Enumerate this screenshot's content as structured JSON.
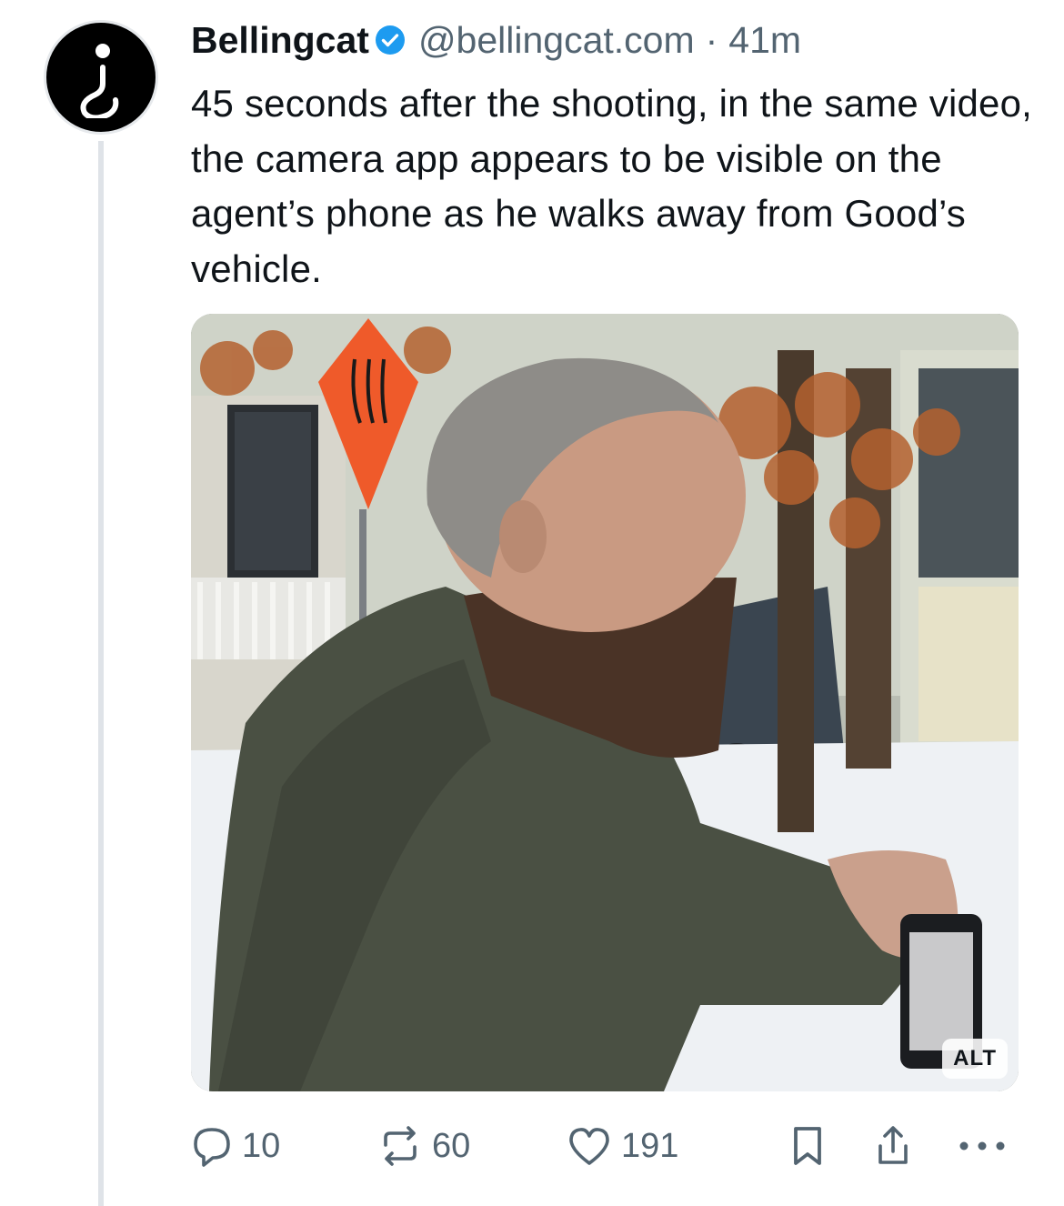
{
  "post": {
    "author": {
      "display_name": "Bellingcat",
      "handle": "@bellingcat.com",
      "separator": "·",
      "time": "41m",
      "verified": true,
      "avatar_icon": "inverted-question-mark-icon"
    },
    "text": "45 seconds after the shooting, in the same video, the camera app appears to be visible on the agent’s phone as he walks away from Good’s vehicle.",
    "media": {
      "alt_badge": "ALT"
    },
    "actions": {
      "replies": "10",
      "reposts": "60",
      "likes": "191"
    }
  },
  "colors": {
    "text_primary": "#0f1419",
    "text_secondary": "#536471",
    "verified_blue": "#1d9bf0",
    "thread_line": "#dfe3e8"
  }
}
